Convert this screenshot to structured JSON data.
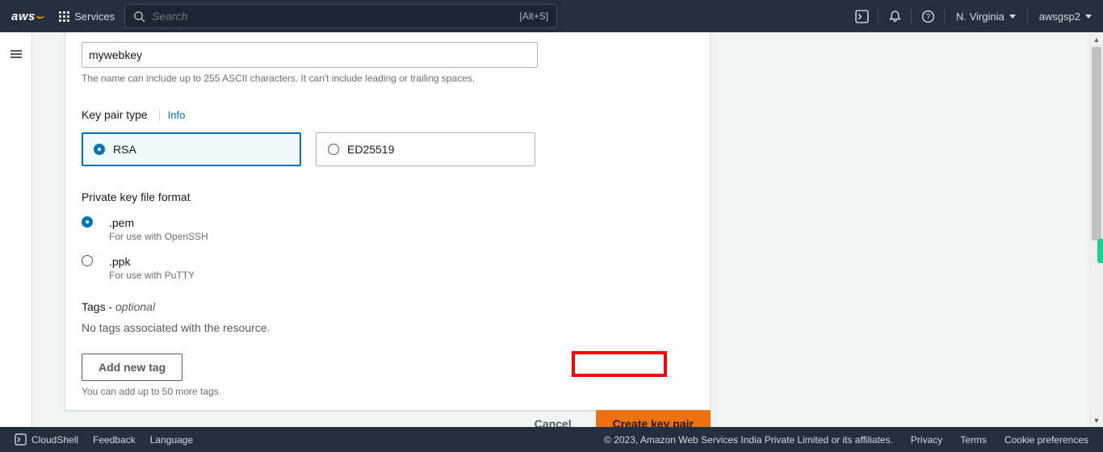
{
  "nav": {
    "logo_text": "aws",
    "services_label": "Services",
    "search_placeholder": "Search",
    "search_hint": "[Alt+S]",
    "region": "N. Virginia",
    "account": "awsgsp2"
  },
  "form": {
    "name_value": "mywebkey",
    "name_hint": "The name can include up to 255 ASCII characters. It can't include leading or trailing spaces.",
    "type_label": "Key pair type",
    "info_label": "Info",
    "type_options": {
      "rsa": "RSA",
      "ed": "ED25519"
    },
    "format_label": "Private key file format",
    "formats": {
      "pem": {
        "label": ".pem",
        "desc": "For use with OpenSSH"
      },
      "ppk": {
        "label": ".ppk",
        "desc": "For use with PuTTY"
      }
    },
    "tags_label": "Tags - ",
    "tags_optional": "optional",
    "tags_empty": "No tags associated with the resource.",
    "add_tag": "Add new tag",
    "add_tag_hint": "You can add up to 50 more tags."
  },
  "actions": {
    "cancel": "Cancel",
    "create": "Create key pair"
  },
  "footer": {
    "cloudshell": "CloudShell",
    "feedback": "Feedback",
    "language": "Language",
    "copyright": "© 2023, Amazon Web Services India Private Limited or its affiliates.",
    "privacy": "Privacy",
    "terms": "Terms",
    "cookies": "Cookie preferences"
  }
}
